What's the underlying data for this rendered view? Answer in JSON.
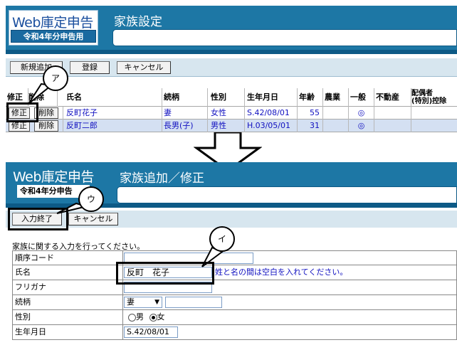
{
  "top": {
    "logo_main": "Web庫定申告",
    "logo_sub": "令和4年分申告用",
    "title": "家族設定",
    "buttons": {
      "new": "新規追加",
      "register": "登録",
      "cancel": "キャンセル"
    },
    "columns": [
      "修正",
      "削除",
      "氏名",
      "続柄",
      "性別",
      "生年月日",
      "年齢",
      "農業",
      "一般",
      "不動産",
      "配偶者\n(特別)控除"
    ],
    "row_buttons": {
      "edit": "修正",
      "delete": "削除"
    },
    "rows": [
      {
        "name": "反町花子",
        "relation": "妻",
        "gender": "女性",
        "birthday": "S.42/08/01",
        "age": "55",
        "general": "◎"
      },
      {
        "name": "反町二郎",
        "relation": "長男(子)",
        "gender": "男性",
        "birthday": "H.03/05/01",
        "age": "31",
        "general": "◎"
      }
    ]
  },
  "bottom": {
    "logo_main": "Web庫定申告",
    "logo_sub": "令和4年分申告",
    "title": "家族追加／修正",
    "buttons": {
      "done": "入力終了",
      "cancel": "キャンセル"
    },
    "instruction": "家族に関する入力を行ってください。",
    "fields": {
      "order_label": "順序コード",
      "order_value": "",
      "name_label": "氏名",
      "name_value": "反町　花子",
      "name_hint": "姓と名の間は空白を入れてください。",
      "furigana_label": "フリガナ",
      "furigana_value": "",
      "relation_label": "続柄",
      "relation_value": "妻",
      "relation_extra": "",
      "gender_label": "性別",
      "gender_male": "男",
      "gender_female": "女",
      "gender_selected": "女",
      "birthday_label": "生年月日",
      "birthday_value": "S.42/08/01"
    }
  },
  "callouts": {
    "a": "ア",
    "b": "イ",
    "c": "ウ"
  },
  "colors": {
    "header": "#1d77a5",
    "toolbar": "#d7e6ef",
    "link": "#1010c0"
  }
}
